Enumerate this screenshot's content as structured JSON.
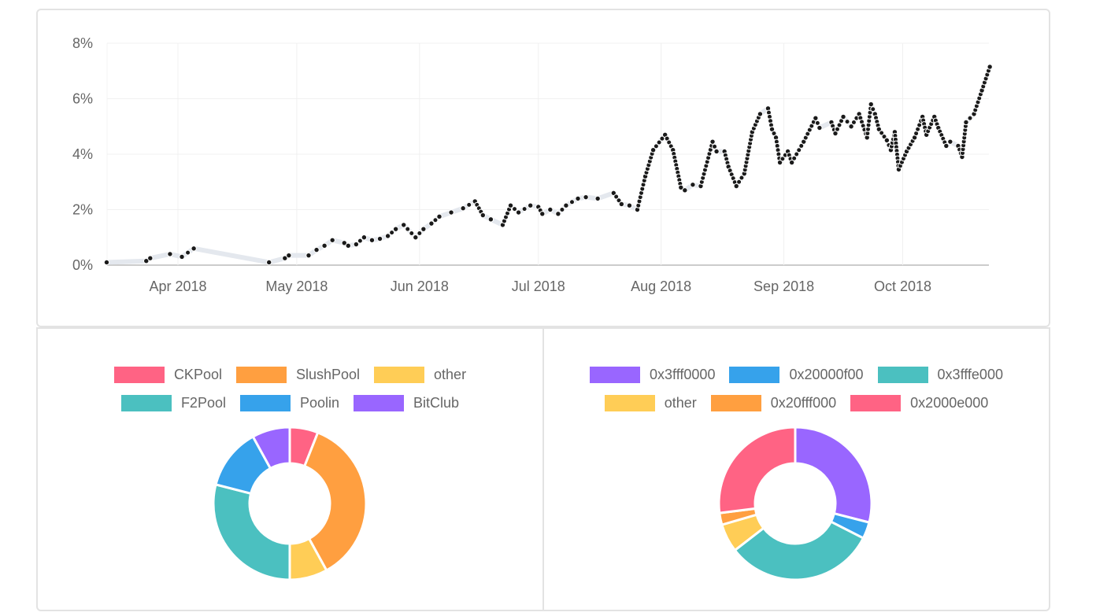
{
  "chart_data": [
    {
      "type": "line",
      "title": "",
      "xlabel": "",
      "ylabel": "",
      "ylim": [
        0,
        8
      ],
      "y_ticks": [
        "0%",
        "2%",
        "4%",
        "6%",
        "8%"
      ],
      "y_tick_values": [
        0,
        2,
        4,
        6,
        8
      ],
      "x_ticks": [
        "Apr 2018",
        "May 2018",
        "Jun 2018",
        "Jul 2018",
        "Aug 2018",
        "Sep 2018",
        "Oct 2018"
      ],
      "x_tick_days": [
        0,
        30,
        61,
        91,
        122,
        153,
        183
      ],
      "x_unit": "days since 2018-04-01",
      "xlim": [
        -18,
        205
      ],
      "grid": true,
      "legend": "none",
      "series": [
        {
          "name": "share",
          "line_color": "#e4e8ee",
          "point_color": "#1a1a1a",
          "points": [
            [
              -18,
              0.1
            ],
            [
              -8,
              0.15
            ],
            [
              -7,
              0.25
            ],
            [
              -2,
              0.4
            ],
            [
              1,
              0.3
            ],
            [
              4,
              0.6
            ],
            [
              23,
              0.1
            ],
            [
              27,
              0.25
            ],
            [
              28,
              0.35
            ],
            [
              33,
              0.35
            ],
            [
              35,
              0.55
            ],
            [
              37,
              0.7
            ],
            [
              39,
              0.9
            ],
            [
              42,
              0.8
            ],
            [
              43,
              0.7
            ],
            [
              45,
              0.75
            ],
            [
              47,
              1.0
            ],
            [
              49,
              0.9
            ],
            [
              51,
              0.95
            ],
            [
              53,
              1.05
            ],
            [
              55,
              1.3
            ],
            [
              57,
              1.45
            ],
            [
              60,
              1.0
            ],
            [
              62,
              1.3
            ],
            [
              64,
              1.5
            ],
            [
              66,
              1.75
            ],
            [
              69,
              1.9
            ],
            [
              72,
              2.05
            ],
            [
              75,
              2.3
            ],
            [
              77,
              1.8
            ],
            [
              79,
              1.65
            ],
            [
              82,
              1.45
            ],
            [
              84,
              2.15
            ],
            [
              86,
              1.9
            ],
            [
              89,
              2.15
            ],
            [
              91,
              2.1
            ],
            [
              92,
              1.85
            ],
            [
              94,
              2.0
            ],
            [
              96,
              1.85
            ],
            [
              98,
              2.15
            ],
            [
              101,
              2.4
            ],
            [
              103,
              2.45
            ],
            [
              106,
              2.4
            ],
            [
              110,
              2.6
            ],
            [
              112,
              2.2
            ],
            [
              114,
              2.15
            ],
            [
              116,
              2.0
            ],
            [
              118,
              3.2
            ],
            [
              120,
              4.15
            ],
            [
              123,
              4.7
            ],
            [
              125,
              4.15
            ],
            [
              127,
              2.8
            ],
            [
              128,
              2.7
            ],
            [
              130,
              2.9
            ],
            [
              132,
              2.85
            ],
            [
              135,
              4.45
            ],
            [
              136,
              4.1
            ],
            [
              138,
              4.1
            ],
            [
              139,
              3.55
            ],
            [
              141,
              2.85
            ],
            [
              143,
              3.3
            ],
            [
              145,
              4.8
            ],
            [
              147,
              5.45
            ],
            [
              149,
              5.65
            ],
            [
              150,
              4.9
            ],
            [
              151,
              4.6
            ],
            [
              152,
              3.7
            ],
            [
              154,
              4.1
            ],
            [
              155,
              3.7
            ],
            [
              158,
              4.45
            ],
            [
              161,
              5.3
            ],
            [
              162,
              4.95
            ],
            [
              165,
              5.15
            ],
            [
              166,
              4.75
            ],
            [
              168,
              5.35
            ],
            [
              170,
              5.0
            ],
            [
              172,
              5.45
            ],
            [
              174,
              4.6
            ],
            [
              175,
              5.8
            ],
            [
              176,
              5.45
            ],
            [
              177,
              4.9
            ],
            [
              179,
              4.5
            ],
            [
              180,
              4.15
            ],
            [
              181,
              4.8
            ],
            [
              182,
              3.45
            ],
            [
              184,
              4.1
            ],
            [
              186,
              4.6
            ],
            [
              188,
              5.35
            ],
            [
              189,
              4.7
            ],
            [
              191,
              5.35
            ],
            [
              192,
              4.95
            ],
            [
              194,
              4.3
            ],
            [
              195,
              4.45
            ],
            [
              197,
              4.3
            ],
            [
              198,
              3.9
            ],
            [
              199,
              5.15
            ],
            [
              201,
              5.45
            ],
            [
              203,
              6.3
            ],
            [
              205,
              7.15
            ]
          ]
        }
      ]
    },
    {
      "type": "pie",
      "variant": "doughnut",
      "title": "",
      "legend": "top",
      "labels": [
        "CKPool",
        "SlushPool",
        "other",
        "F2Pool",
        "Poolin",
        "BitClub"
      ],
      "values": [
        6,
        36,
        8,
        29,
        13,
        8
      ],
      "colors": [
        "#ff6384",
        "#ff9f40",
        "#ffcd56",
        "#4bc0c0",
        "#36a2eb",
        "#9966ff"
      ]
    },
    {
      "type": "pie",
      "variant": "doughnut",
      "title": "",
      "legend": "top",
      "labels": [
        "0x3fff0000",
        "0x20000f00",
        "0x3fffe000",
        "other",
        "0x20fff000",
        "0x2000e000"
      ],
      "values": [
        29,
        3.5,
        32,
        6,
        2.5,
        27
      ],
      "colors": [
        "#9966ff",
        "#36a2eb",
        "#4bc0c0",
        "#ffcd56",
        "#ff9f40",
        "#ff6384"
      ]
    }
  ]
}
